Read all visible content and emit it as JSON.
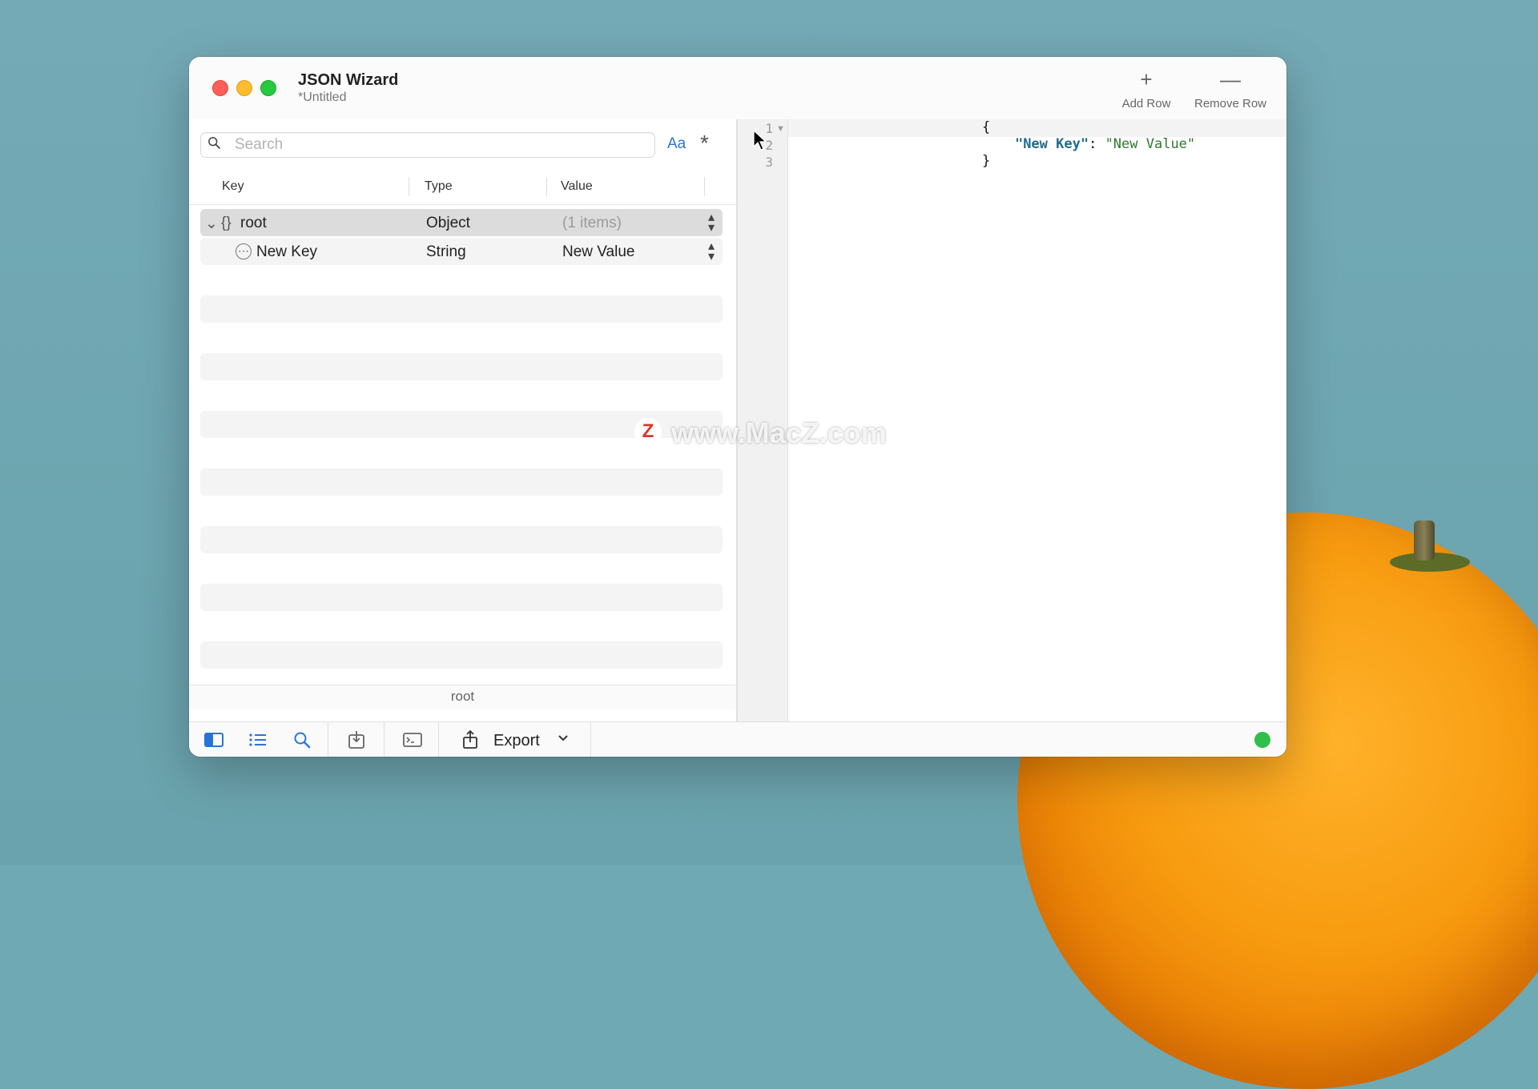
{
  "window": {
    "app_title": "JSON Wizard",
    "doc_title": "*Untitled"
  },
  "toolbar": {
    "add_row": {
      "symbol": "+",
      "label": "Add Row"
    },
    "remove_row": {
      "symbol": "—",
      "label": "Remove Row"
    }
  },
  "search": {
    "placeholder": "Search",
    "value": "",
    "case_label": "Aa",
    "regex_label": "*"
  },
  "columns": [
    "Key",
    "Type",
    "Value"
  ],
  "tree": [
    {
      "toggle": "⌄",
      "icon": "{}",
      "key": "root",
      "type": "Object",
      "value": "(1 items)"
    },
    {
      "icon": "⋯",
      "key": "New Key",
      "type": "String",
      "value": "New Value"
    }
  ],
  "path_bar": "root",
  "editor": {
    "line_numbers": [
      "1",
      "2",
      "3"
    ],
    "lines": [
      {
        "text": "{"
      },
      {
        "indent": "    ",
        "key": "\"New Key\"",
        "sep": ": ",
        "value": "\"New Value\""
      },
      {
        "text": "}"
      }
    ]
  },
  "bottom_toolbar": {
    "export_label": "Export"
  },
  "status": {
    "color": "#2fbf4a"
  },
  "watermark": {
    "logo": "Z",
    "text": "www.MacZ.com"
  }
}
